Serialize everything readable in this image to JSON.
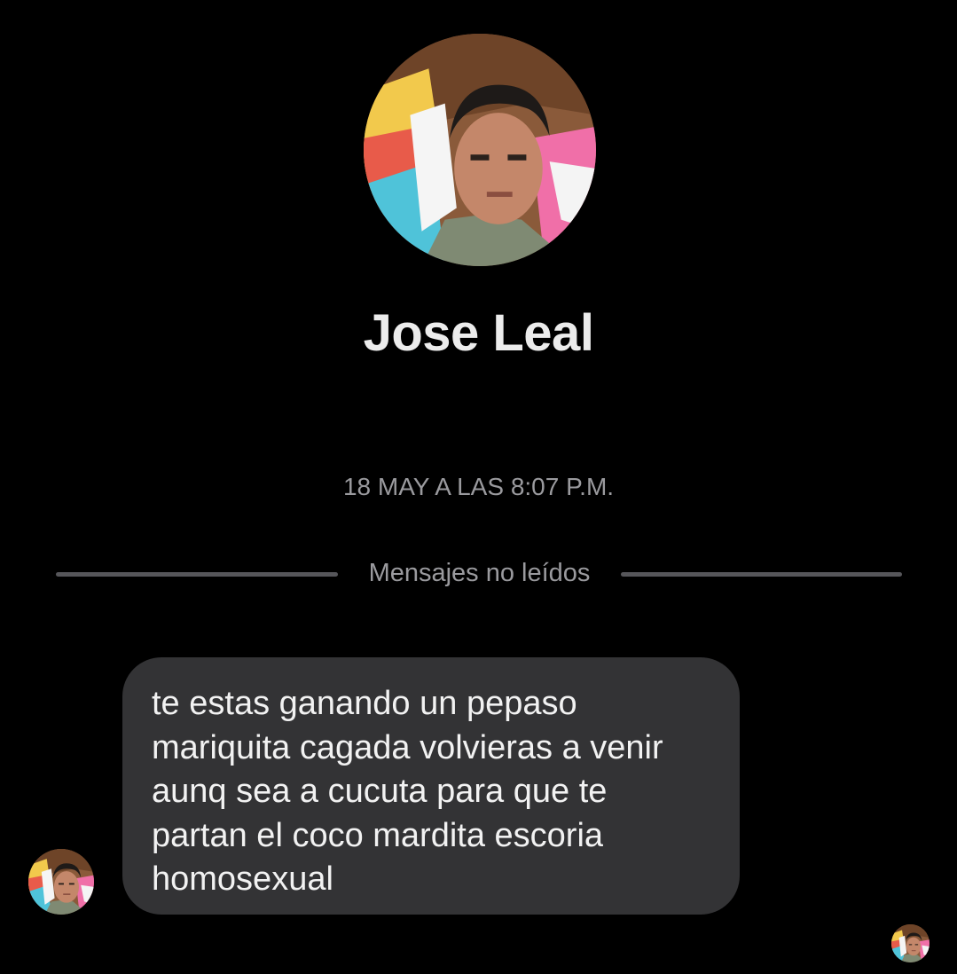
{
  "profile": {
    "name": "Jose Leal",
    "avatar_icon": "profile-photo"
  },
  "thread": {
    "timestamp": "18 MAY A LAS 8:07 P.M.",
    "unread_divider_label": "Mensajes no leídos"
  },
  "messages": [
    {
      "text": "te estas ganando un pepaso\nmariquita cagada volvieras a venir\naunq sea a cucuta para que te\npartan el coco mardita escoria\nhomosexual"
    }
  ],
  "colors": {
    "background": "#000000",
    "bubble": "#333335",
    "name_text": "#ececec",
    "muted_text": "#9a9a9e",
    "divider": "#56565a"
  }
}
